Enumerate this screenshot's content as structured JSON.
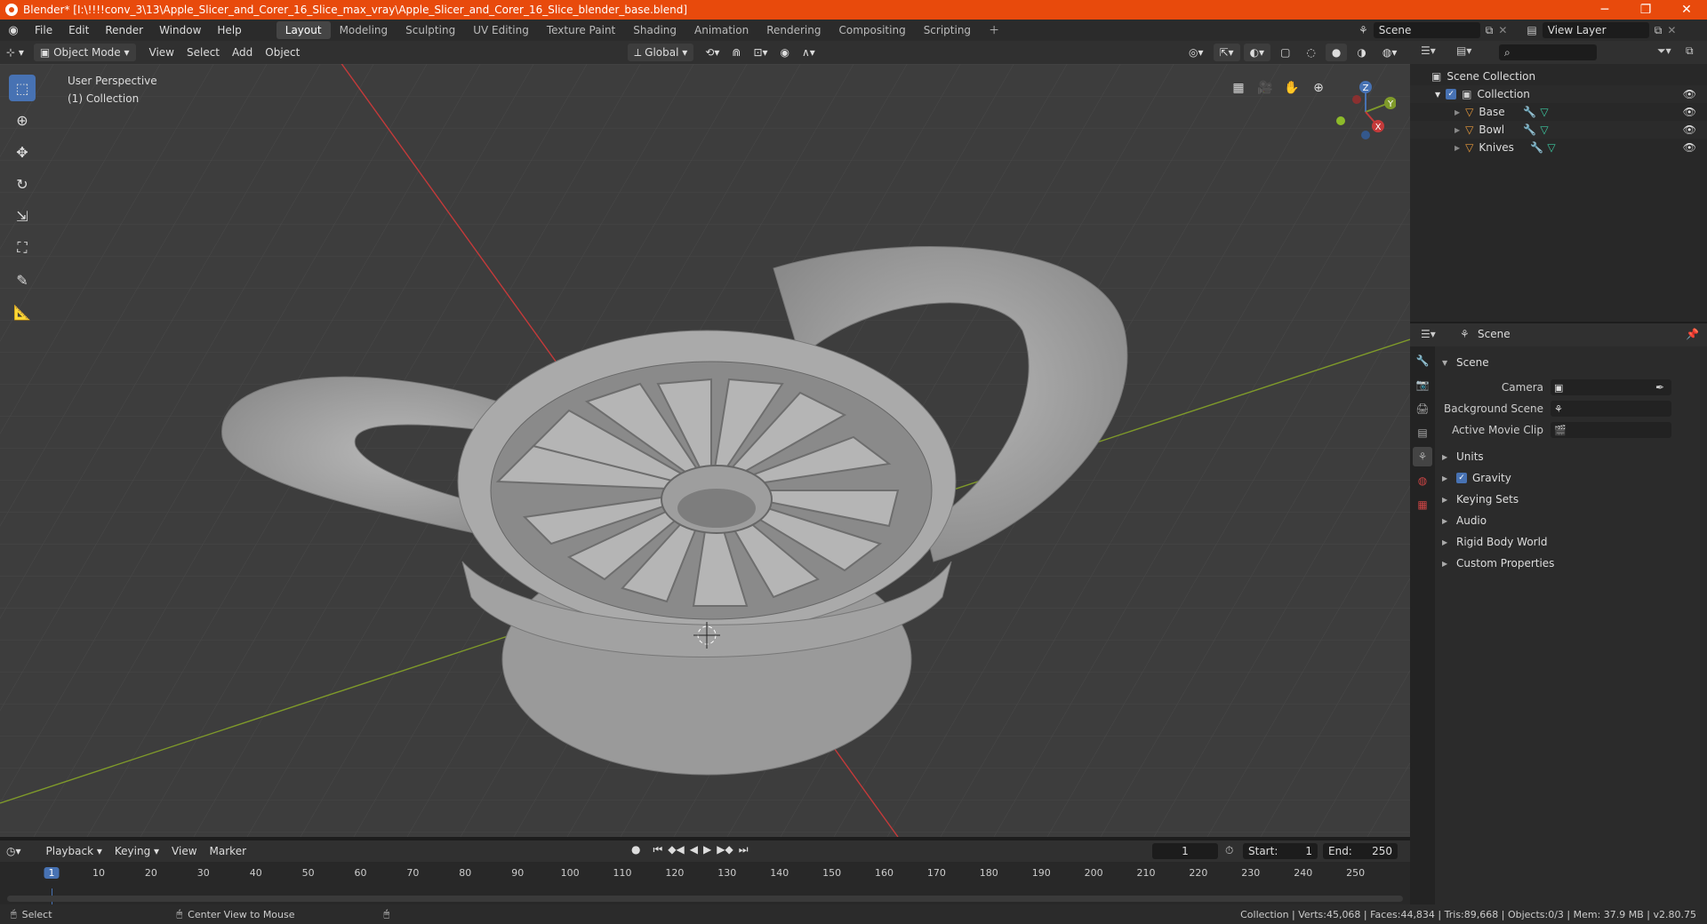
{
  "title": "Blender* [I:\\!!!!conv_3\\13\\Apple_Slicer_and_Corer_16_Slice_max_vray\\Apple_Slicer_and_Corer_16_Slice_blender_base.blend]",
  "menus": [
    "File",
    "Edit",
    "Render",
    "Window",
    "Help"
  ],
  "workspaces": [
    "Layout",
    "Modeling",
    "Sculpting",
    "UV Editing",
    "Texture Paint",
    "Shading",
    "Animation",
    "Rendering",
    "Compositing",
    "Scripting"
  ],
  "active_workspace": "Layout",
  "scene_field": "Scene",
  "view_layer_field": "View Layer",
  "viewport_header": {
    "mode": "Object Mode",
    "menus": [
      "View",
      "Select",
      "Add",
      "Object"
    ],
    "transform_orientation": "Global"
  },
  "viewport_overlay": {
    "perspective": "User Perspective",
    "collection": "(1) Collection"
  },
  "gizmo": {
    "z": "Z",
    "y": "Y",
    "x": "X"
  },
  "outliner": {
    "root": "Scene Collection",
    "collection": "Collection",
    "objects": [
      "Base",
      "Bowl",
      "Knives"
    ]
  },
  "properties": {
    "header": "Scene",
    "panel": "Scene",
    "fields": [
      {
        "label": "Camera",
        "value": ""
      },
      {
        "label": "Background Scene",
        "value": ""
      },
      {
        "label": "Active Movie Clip",
        "value": ""
      }
    ],
    "subpanels": [
      "Units",
      "Gravity",
      "Keying Sets",
      "Audio",
      "Rigid Body World",
      "Custom Properties"
    ]
  },
  "timeline": {
    "menus": [
      "Playback",
      "Keying",
      "View",
      "Marker"
    ],
    "current_frame": "1",
    "start_label": "Start:",
    "start": "1",
    "end_label": "End:",
    "end": "250",
    "ticks": [
      "1",
      "10",
      "20",
      "30",
      "40",
      "50",
      "60",
      "70",
      "80",
      "90",
      "100",
      "110",
      "120",
      "130",
      "140",
      "150",
      "160",
      "170",
      "180",
      "190",
      "200",
      "210",
      "220",
      "230",
      "240",
      "250"
    ]
  },
  "statusbar": {
    "left1": "Select",
    "left2": "Center View to Mouse",
    "right": "Collection | Verts:45,068 | Faces:44,834 | Tris:89,668 | Objects:0/3 | Mem: 37.9 MB | v2.80.75"
  },
  "colors": {
    "accent": "#4772b3",
    "title": "#e84a0c",
    "x_axis": "#c43a3a",
    "y_axis": "#7f9a2a"
  }
}
